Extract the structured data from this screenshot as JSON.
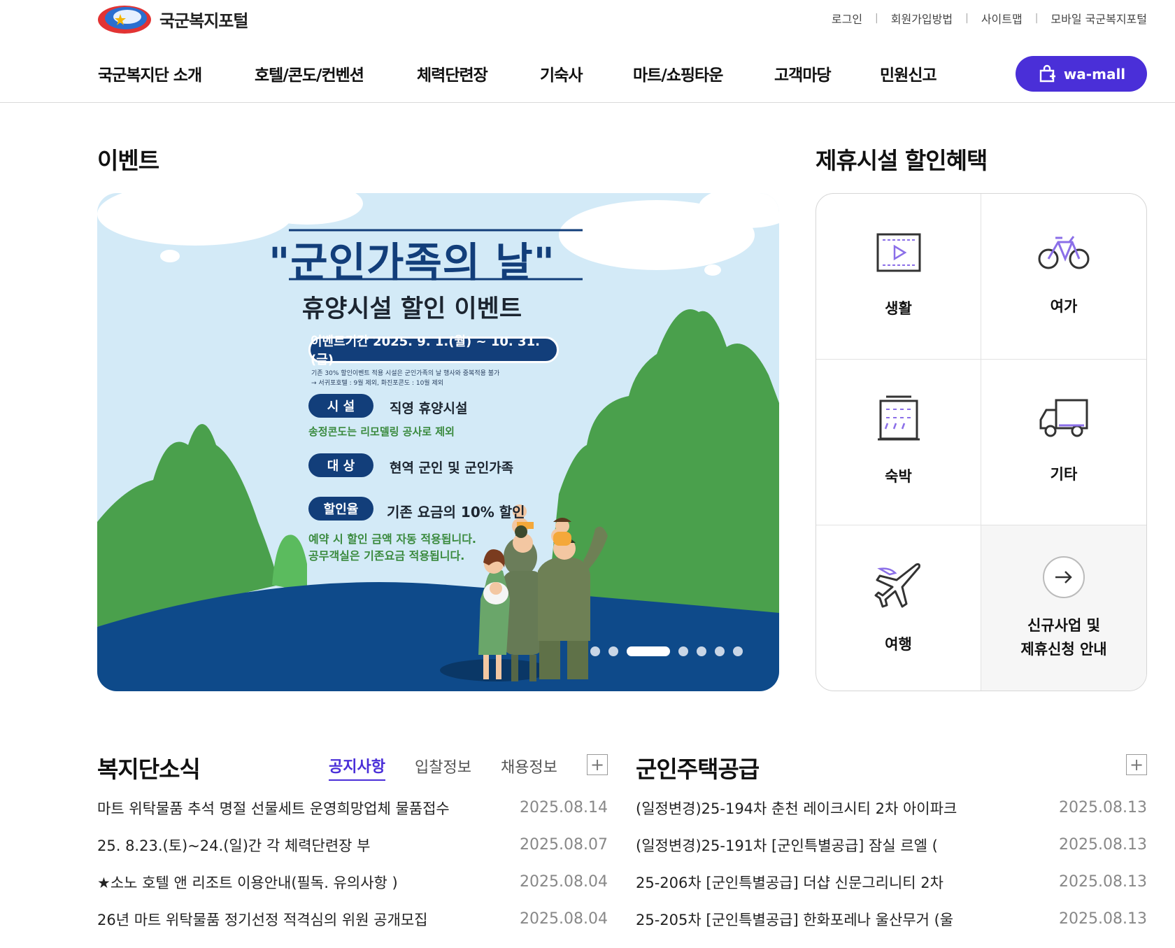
{
  "site": {
    "logo_text": "국군복지포털"
  },
  "util_links": [
    "로그인",
    "회원가입방법",
    "사이트맵",
    "모바일 국군복지포털"
  ],
  "nav": [
    "국군복지단 소개",
    "호텔/콘도/컨벤션",
    "체력단련장",
    "기숙사",
    "마트/쇼핑타운",
    "고객마당",
    "민원신고"
  ],
  "wamall": {
    "label": "wa-mall",
    "icon": "shopping-bag-icon"
  },
  "event": {
    "title": "이벤트",
    "banner": {
      "headline": "\"군인가족의 날\"",
      "subheadline": "휴양시설 할인 이벤트",
      "period": "이벤트기간 2025. 9. 1.(월) ~ 10. 31.(금)",
      "note1": "기존 30% 할인이벤트 적용 시설은 군인가족의 날 행사와 중복적용 불가",
      "note2": "→ 서귀포호텔 : 9월 제외, 화진포콘도 : 10월 제외",
      "facility_label": "시  설",
      "facility_value": "직영 휴양시설",
      "facility_note": "송정콘도는 리모델링 공사로 제외",
      "target_label": "대  상",
      "target_value": "현역 군인 및 군인가족",
      "rate_label": "할인율",
      "rate_value": "기존 요금의 10% 할인",
      "footnote1": "예약 시 할인 금액 자동 적용됩니다.",
      "footnote2": "공무객실은 기존요금 적용됩니다."
    },
    "slides_total": 7,
    "slide_active": 3
  },
  "partner": {
    "title": "제휴시설 할인혜택",
    "items": [
      {
        "label": "생활",
        "icon": "video-play-icon"
      },
      {
        "label": "여가",
        "icon": "bicycle-icon"
      },
      {
        "label": "숙박",
        "icon": "building-icon"
      },
      {
        "label": "기타",
        "icon": "truck-icon"
      },
      {
        "label": "여행",
        "icon": "airplane-icon"
      },
      {
        "label_line1": "신규사업 및",
        "label_line2": "제휴신청 안내",
        "icon": "arrow-right-circle-icon"
      }
    ]
  },
  "news": {
    "title": "복지단소식",
    "tabs": [
      "공지사항",
      "입찰정보",
      "채용정보"
    ],
    "more": "+",
    "items": [
      {
        "title": "마트 위탁물품 추석 명절 선물세트 운영희망업체 물품접수",
        "date": "2025.08.14"
      },
      {
        "title": "25. 8.23.(토)~24.(일)간 각 체력단련장 부",
        "date": "2025.08.07"
      },
      {
        "title": "★소노 호텔 앤 리조트 이용안내(필독. 유의사항 )",
        "date": "2025.08.04"
      },
      {
        "title": "26년 마트 위탁물품 정기선정 적격심의 위원 공개모집",
        "date": "2025.08.04"
      }
    ]
  },
  "housing": {
    "title": "군인주택공급",
    "more": "+",
    "items": [
      {
        "title": "(일정변경)25-194차 춘천 레이크시티 2차 아이파크",
        "date": "2025.08.13"
      },
      {
        "title": "(일정변경)25-191차 [군인특별공급] 잠실 르엘 (",
        "date": "2025.08.13"
      },
      {
        "title": "25-206차 [군인특별공급] 더샵 신문그리니티 2차",
        "date": "2025.08.13"
      },
      {
        "title": "25-205차 [군인특별공급] 한화포레나 울산무거 (울",
        "date": "2025.08.13"
      }
    ]
  },
  "colors": {
    "accent": "#4a2fd8",
    "navy": "#123e7a",
    "green": "#4aa04c",
    "sky": "#d3eaf7"
  }
}
